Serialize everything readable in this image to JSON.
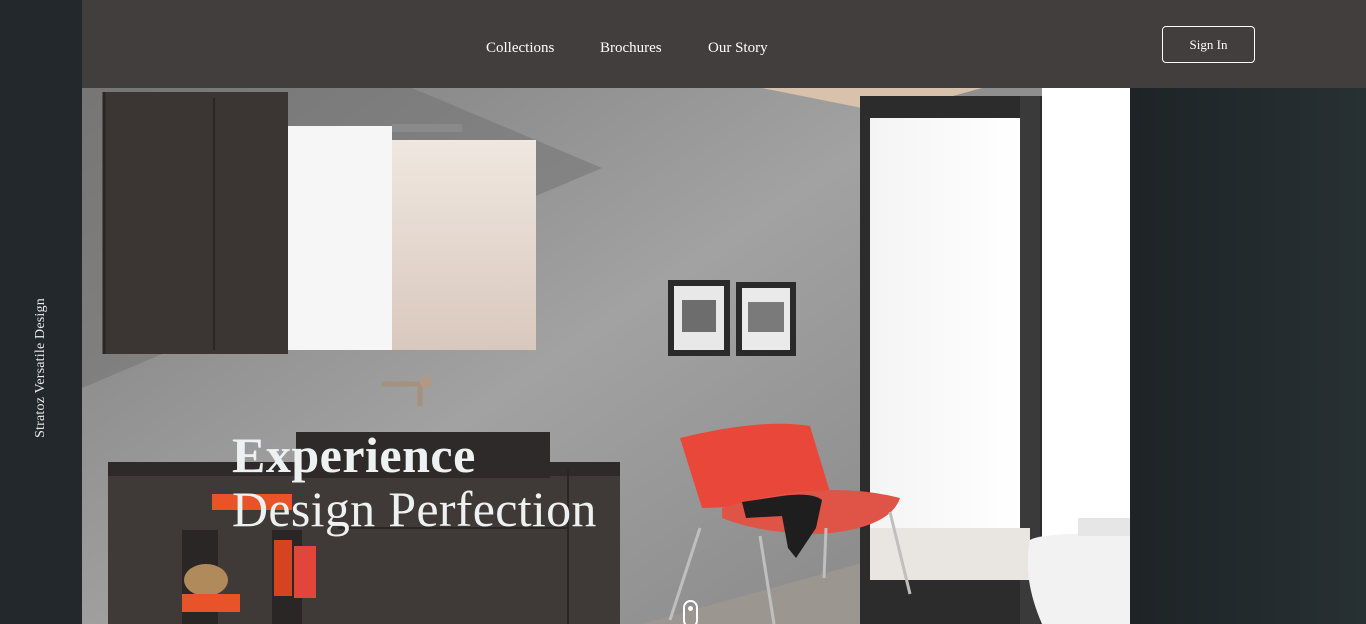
{
  "sidebar": {
    "tagline": "Stratoz Versatile Design"
  },
  "nav": {
    "links": [
      {
        "label": "Collections"
      },
      {
        "label": "Brochures"
      },
      {
        "label": "Our Story"
      }
    ],
    "signin_label": "Sign In"
  },
  "hero": {
    "headline_line1": "Experience",
    "headline_line2": "Design Perfection"
  },
  "colors": {
    "topbar": "#423e3d",
    "sidebar": "#22282b",
    "accent_chair": "#e8473a",
    "text": "#ffffff"
  }
}
